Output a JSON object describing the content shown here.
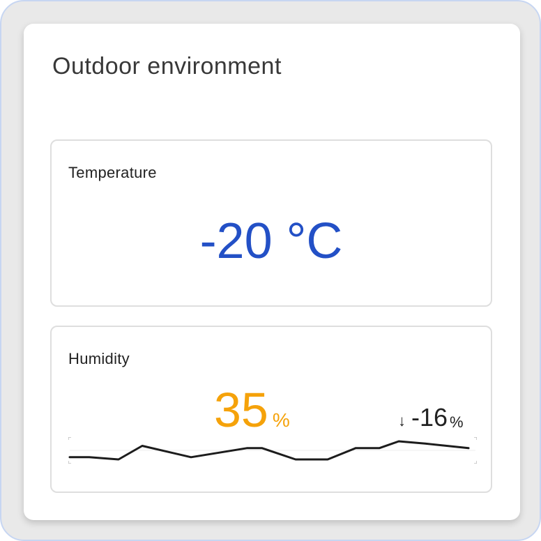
{
  "card": {
    "title": "Outdoor environment"
  },
  "temperature": {
    "label": "Temperature",
    "value": "-20 °C",
    "color": "#2350c6"
  },
  "humidity": {
    "label": "Humidity",
    "value": "35",
    "unit": "%",
    "color": "#f5a20a",
    "trend": {
      "icon": "arrow-down-icon",
      "symbol": "↓",
      "value": "-16",
      "unit": "%"
    },
    "sparkline": [
      24,
      24,
      23,
      29,
      24,
      28,
      28,
      23,
      23,
      28,
      28,
      31,
      30,
      28
    ]
  }
}
